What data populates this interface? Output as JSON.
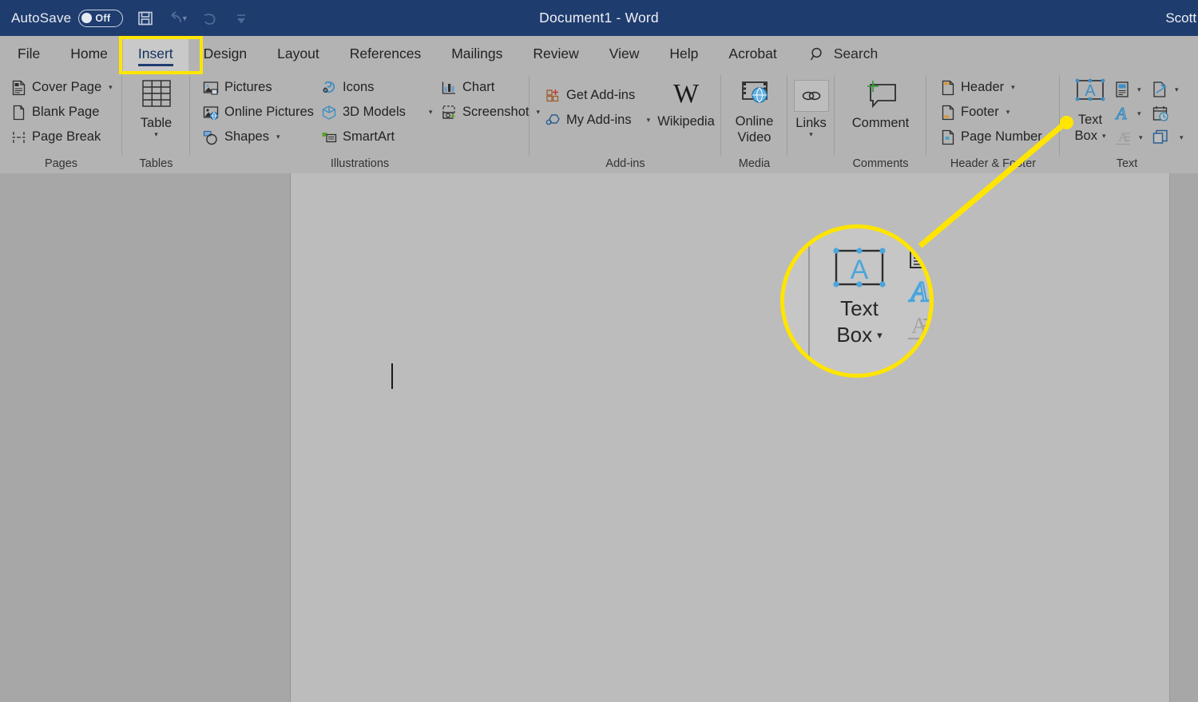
{
  "titlebar": {
    "autosave_label": "AutoSave",
    "autosave_state": "Off",
    "save_icon": "save-icon",
    "undo_icon": "undo-icon",
    "redo_icon": "redo-icon",
    "customize_icon": "customize-quick-access-toolbar-icon",
    "document_title": "Document1  -  Word",
    "user_name": "Scott O",
    "bg_color": "#1F3C6E"
  },
  "tabs": [
    {
      "label": "File",
      "active": false
    },
    {
      "label": "Home",
      "active": false
    },
    {
      "label": "Insert",
      "active": true
    },
    {
      "label": "Design",
      "active": false
    },
    {
      "label": "Layout",
      "active": false
    },
    {
      "label": "References",
      "active": false
    },
    {
      "label": "Mailings",
      "active": false
    },
    {
      "label": "Review",
      "active": false
    },
    {
      "label": "View",
      "active": false
    },
    {
      "label": "Help",
      "active": false
    },
    {
      "label": "Acrobat",
      "active": false
    }
  ],
  "search": {
    "label": "Search",
    "icon": "search-icon"
  },
  "highlights": {
    "tab_highlight_color": "#FFE500",
    "callout_color": "#FFE500",
    "highlighted_tab": "Insert",
    "callout_target": "Text Box"
  },
  "ribbon": {
    "groups": [
      {
        "name": "Pages",
        "label": "Pages",
        "items": [
          {
            "label": "Cover Page",
            "icon": "cover-page-icon",
            "dropdown": true
          },
          {
            "label": "Blank Page",
            "icon": "blank-page-icon",
            "dropdown": false
          },
          {
            "label": "Page Break",
            "icon": "page-break-icon",
            "dropdown": false
          }
        ]
      },
      {
        "name": "Tables",
        "label": "Tables",
        "items": [
          {
            "label": "Table",
            "icon": "table-icon",
            "dropdown": true
          }
        ]
      },
      {
        "name": "Illustrations",
        "label": "Illustrations",
        "items": [
          {
            "label": "Pictures",
            "icon": "pictures-icon",
            "dropdown": false
          },
          {
            "label": "Online Pictures",
            "icon": "online-pictures-icon",
            "dropdown": false
          },
          {
            "label": "Shapes",
            "icon": "shapes-icon",
            "dropdown": true
          },
          {
            "label": "Icons",
            "icon": "icons-icon",
            "dropdown": false
          },
          {
            "label": "3D Models",
            "icon": "3d-models-icon",
            "dropdown": true
          },
          {
            "label": "SmartArt",
            "icon": "smartart-icon",
            "dropdown": false
          },
          {
            "label": "Chart",
            "icon": "chart-icon",
            "dropdown": false
          },
          {
            "label": "Screenshot",
            "icon": "screenshot-icon",
            "dropdown": true
          }
        ]
      },
      {
        "name": "Add-ins",
        "label": "Add-ins",
        "items": [
          {
            "label": "Get Add-ins",
            "icon": "get-add-ins-icon",
            "dropdown": false
          },
          {
            "label": "My Add-ins",
            "icon": "my-add-ins-icon",
            "dropdown": true
          },
          {
            "label": "Wikipedia",
            "icon": "wikipedia-icon",
            "dropdown": false
          }
        ]
      },
      {
        "name": "Media",
        "label": "Media",
        "items": [
          {
            "label": "Online\nVideo",
            "label_line1": "Online",
            "label_line2": "Video",
            "icon": "online-video-icon",
            "dropdown": false
          }
        ]
      },
      {
        "name": "Links",
        "label": "",
        "items": [
          {
            "label": "Links",
            "icon": "links-icon",
            "dropdown": true
          }
        ]
      },
      {
        "name": "Comments",
        "label": "Comments",
        "items": [
          {
            "label": "Comment",
            "icon": "comment-icon",
            "dropdown": false
          }
        ]
      },
      {
        "name": "Header & Footer",
        "label": "Header & Footer",
        "items": [
          {
            "label": "Header",
            "icon": "header-icon",
            "dropdown": true
          },
          {
            "label": "Footer",
            "icon": "footer-icon",
            "dropdown": true
          },
          {
            "label": "Page Number",
            "icon": "page-number-icon",
            "dropdown": true
          }
        ]
      },
      {
        "name": "Text",
        "label": "Text",
        "items": [
          {
            "label": "Text Box",
            "label_line1": "Text",
            "label_line2": "Box",
            "icon": "text-box-icon",
            "dropdown": true
          },
          {
            "label": "Quick Parts",
            "icon": "quick-parts-icon",
            "dropdown": true
          },
          {
            "label": "WordArt",
            "icon": "wordart-icon",
            "dropdown": true
          },
          {
            "label": "Drop Cap",
            "icon": "drop-cap-icon",
            "dropdown": true
          },
          {
            "label": "Signature Line",
            "icon": "signature-line-icon",
            "dropdown": true
          },
          {
            "label": "Date & Time",
            "icon": "date-and-time-icon",
            "dropdown": false
          },
          {
            "label": "Object",
            "icon": "object-icon",
            "dropdown": true
          }
        ]
      }
    ]
  },
  "magnifier": {
    "label_line1": "Text",
    "label_line2": "Box",
    "icon": "text-box-icon",
    "side_icons": [
      "quick-parts-icon",
      "wordart-icon",
      "drop-cap-icon"
    ]
  },
  "document": {
    "cursor": "text-caret",
    "page_background": "#bcbcbc",
    "content": ""
  }
}
